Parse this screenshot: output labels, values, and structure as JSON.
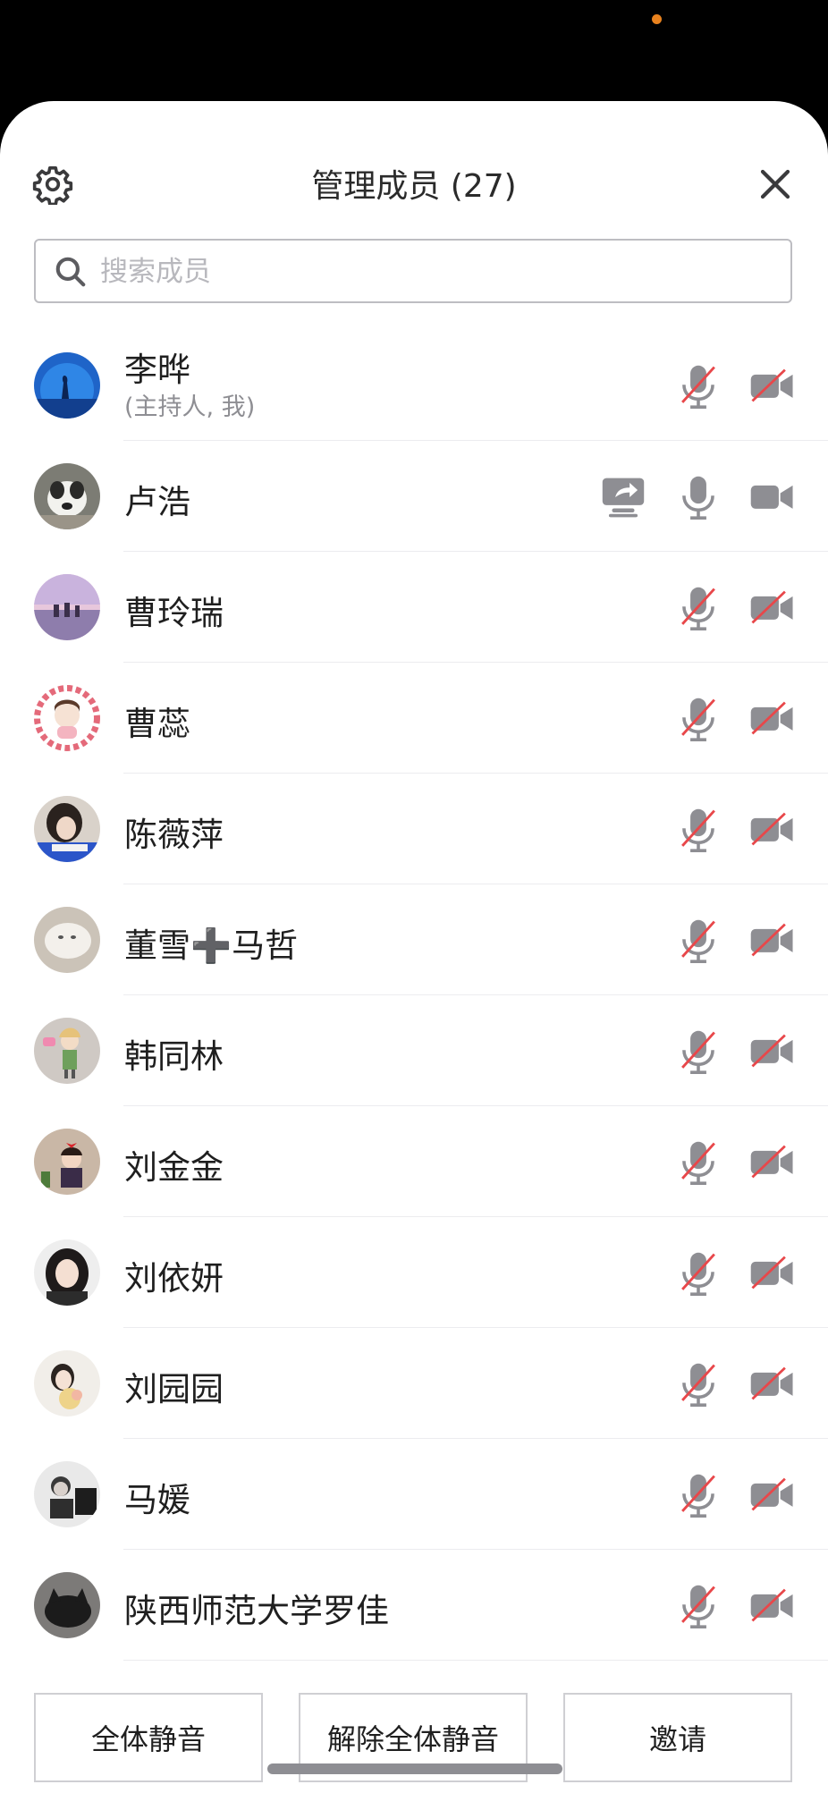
{
  "header": {
    "title": "管理成员 (27)",
    "settings_icon": "gear-icon",
    "close_icon": "close-icon"
  },
  "search": {
    "placeholder": "搜索成员",
    "value": ""
  },
  "colors": {
    "muted_slash": "#e8474a",
    "icon_gray": "#8e8e93"
  },
  "members": [
    {
      "name": "李晔",
      "subtitle": "(主持人, 我)",
      "mic": "off",
      "camera": "off",
      "sharing": false,
      "avatar": "aquarium"
    },
    {
      "name": "卢浩",
      "subtitle": "",
      "mic": "on",
      "camera": "on",
      "sharing": true,
      "avatar": "dog"
    },
    {
      "name": "曹玲瑞",
      "subtitle": "",
      "mic": "off",
      "camera": "off",
      "sharing": false,
      "avatar": "sunset"
    },
    {
      "name": "曹蕊",
      "subtitle": "",
      "mic": "off",
      "camera": "off",
      "sharing": false,
      "avatar": "flowers"
    },
    {
      "name": "陈薇萍",
      "subtitle": "",
      "mic": "off",
      "camera": "off",
      "sharing": false,
      "avatar": "girl-dark"
    },
    {
      "name": "董雪➕马哲",
      "subtitle": "",
      "mic": "off",
      "camera": "off",
      "sharing": false,
      "avatar": "cat"
    },
    {
      "name": "韩同林",
      "subtitle": "",
      "mic": "off",
      "camera": "off",
      "sharing": false,
      "avatar": "cartoon-girl"
    },
    {
      "name": "刘金金",
      "subtitle": "",
      "mic": "off",
      "camera": "off",
      "sharing": false,
      "avatar": "kiki"
    },
    {
      "name": "刘依妍",
      "subtitle": "",
      "mic": "off",
      "camera": "off",
      "sharing": false,
      "avatar": "girl-portrait"
    },
    {
      "name": "刘园园",
      "subtitle": "",
      "mic": "off",
      "camera": "off",
      "sharing": false,
      "avatar": "girl-light"
    },
    {
      "name": "马媛",
      "subtitle": "",
      "mic": "off",
      "camera": "off",
      "sharing": false,
      "avatar": "child-bw"
    },
    {
      "name": "陕西师范大学罗佳",
      "subtitle": "",
      "mic": "off",
      "camera": "off",
      "sharing": false,
      "avatar": "dark-cat"
    }
  ],
  "footer": {
    "mute_all": "全体静音",
    "unmute_all": "解除全体静音",
    "invite": "邀请"
  }
}
